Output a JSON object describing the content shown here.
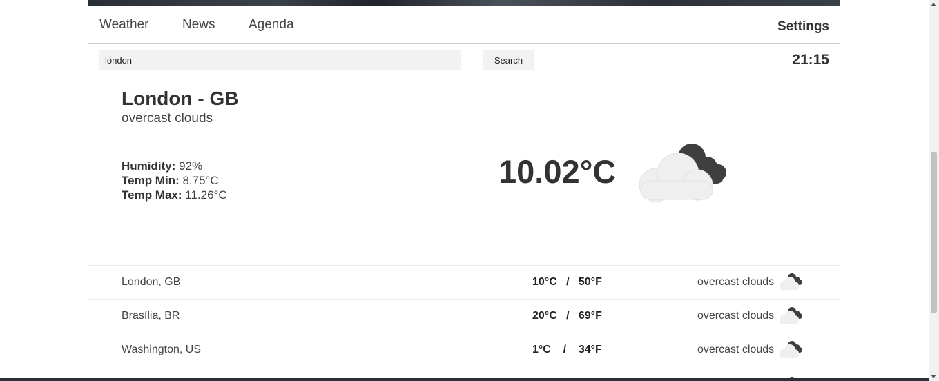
{
  "nav": {
    "weather": "Weather",
    "news": "News",
    "agenda": "Agenda",
    "settings": "Settings"
  },
  "search": {
    "value": "london",
    "button": "Search"
  },
  "clock": "21:15",
  "current": {
    "title": "London - GB",
    "description": "overcast clouds",
    "humidity_label": "Humidity:",
    "humidity": "92%",
    "temp_min_label": "Temp Min:",
    "temp_min": "8.75°C",
    "temp_max_label": "Temp Max:",
    "temp_max": "11.26°C",
    "temperature": "10.02°C",
    "icon": "overcast-clouds-icon"
  },
  "cities": [
    {
      "name": "London, GB",
      "temps": "10°C   /   50°F",
      "desc": "overcast clouds",
      "icon": "overcast-clouds-icon"
    },
    {
      "name": "Brasília, BR",
      "temps": "20°C   /   69°F",
      "desc": "overcast clouds",
      "icon": "overcast-clouds-icon"
    },
    {
      "name": "Washington, US",
      "temps": "1°C    /    34°F",
      "desc": "overcast clouds",
      "icon": "overcast-clouds-icon"
    }
  ],
  "colors": {
    "text": "#333333",
    "field_bg": "#f2f2f2",
    "cloud_light": "#efefef",
    "cloud_dark": "#3f3f3f"
  }
}
